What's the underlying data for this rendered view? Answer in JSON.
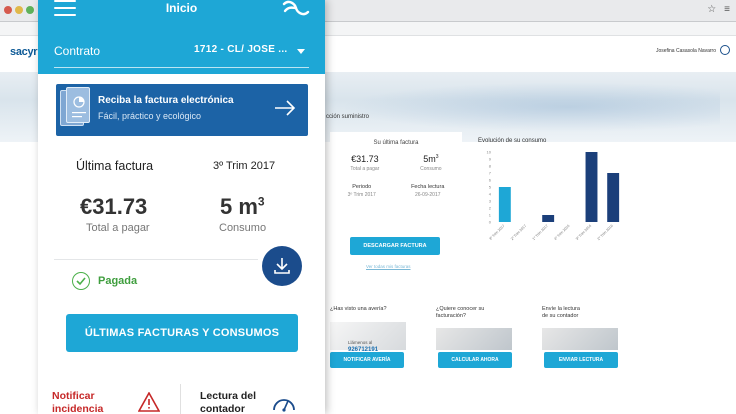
{
  "app": {
    "title": "Inicio",
    "contract_label": "Contrato",
    "contract_value": "1712 - CL/ JOSE ...",
    "banner_title": "Reciba la factura electrónica",
    "banner_subtitle": "Fácil, práctico y ecológico",
    "last_invoice_label": "Última factura",
    "period": "3º Trim 2017",
    "amount": "€31.73",
    "amount_label": "Total a pagar",
    "volume": "5 m",
    "volume_sup": "3",
    "volume_label": "Consumo",
    "paid_label": "Pagada",
    "history_button": "ÚLTIMAS FACTURAS Y CONSUMOS",
    "notify_label_1": "Notificar",
    "notify_label_2": "incidencia",
    "reading_label_1": "Lectura del",
    "reading_label_2": "contador"
  },
  "web": {
    "logo": "sacyr",
    "user": "Josefina Casasola Navarro",
    "supply_label": "cción suministro",
    "card_title": "Su última factura",
    "amount": "€31.73",
    "amount_label": "Total a pagar",
    "volume": "5m",
    "volume_sup": "3",
    "volume_label": "Consumo",
    "period_label": "Periodo",
    "period_value": "3º Trim 2017",
    "reading_date_label": "Fecha lectura",
    "reading_date_value": "26-09-2017",
    "download_button": "DESCARGAR FACTURA",
    "download_link": "Ver todas mis facturas",
    "evo_title": "Evolución de su consumo",
    "tile1_title": "¿Has visto una avería?",
    "tile1_phone_label": "Llámenos al",
    "tile1_phone": "926712191",
    "tile1_button": "NOTIFICAR AVERÍA",
    "tile2_title_1": "¿Quiere conocer su",
    "tile2_title_2": "facturación?",
    "tile2_button": "CALCULAR AHORA",
    "tile3_title_1": "Envíe la lectura",
    "tile3_title_2": "de su contador",
    "tile3_button": "ENVIAR LECTURA"
  },
  "chart_data": {
    "type": "bar",
    "title": "Evolución de su consumo",
    "categories": [
      "3º Trim 2017",
      "2º Trim 2017",
      "1º Trim 2017",
      "4º Trim 2016",
      "3º Trim 2016",
      "2º Trim 2016"
    ],
    "values": [
      5,
      0,
      1,
      0,
      10,
      7
    ],
    "colors": [
      "#1ea7d6",
      "#1b3f7a",
      "#1b3f7a",
      "#1b3f7a",
      "#1b3f7a",
      "#1b3f7a"
    ],
    "yticks": [
      0,
      1,
      2,
      3,
      4,
      5,
      6,
      7,
      8,
      9,
      10
    ],
    "ylim": [
      0,
      10
    ]
  },
  "colors": {
    "accent": "#1ea7d6",
    "navy": "#1c63a6",
    "fab": "#1b4c8c",
    "paid": "#4bb04a",
    "alert": "#c62828"
  }
}
